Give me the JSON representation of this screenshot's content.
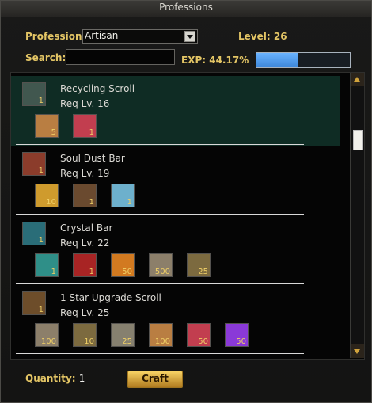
{
  "window": {
    "title": "Professions"
  },
  "header": {
    "profession_label": "Profession:",
    "profession_value": "Artisan",
    "level_label": "Level:",
    "level_value": "26",
    "search_label": "Search:",
    "search_value": "",
    "exp_label": "EXP:",
    "exp_value": "44.17%",
    "exp_fraction": 0.4417
  },
  "recipes": [
    {
      "name": "Recycling Scroll",
      "req": "Req Lv. 16",
      "output_qty": "1",
      "output_icon": "scroll-icon",
      "materials": [
        {
          "icon": "parchment-icon",
          "qty": "5"
        },
        {
          "icon": "red-book-icon",
          "qty": "1"
        }
      ]
    },
    {
      "name": "Soul Dust Bar",
      "req": "Req Lv. 19",
      "output_qty": "1",
      "output_icon": "soul-dust-bar-icon",
      "materials": [
        {
          "icon": "purple-crystal-icon",
          "qty": "10"
        },
        {
          "icon": "gold-coin-icon",
          "qty": "1"
        },
        {
          "icon": "wood-log-icon",
          "qty": "1"
        }
      ]
    },
    {
      "name": "Crystal Bar",
      "req": "Req Lv. 22",
      "output_qty": "1",
      "output_icon": "crystal-bar-icon",
      "materials": [
        {
          "icon": "blue-crystal-icon",
          "qty": "1"
        },
        {
          "icon": "teal-gem-icon",
          "qty": "1"
        },
        {
          "icon": "purple-crystal-icon",
          "qty": "50"
        },
        {
          "icon": "red-shard-icon",
          "qty": "500"
        },
        {
          "icon": "orange-orb-icon",
          "qty": "25"
        }
      ]
    },
    {
      "name": "1 Star Upgrade Scroll",
      "req": "Req Lv. 25",
      "output_qty": "1",
      "output_icon": "upgrade-scroll-icon",
      "materials": [
        {
          "icon": "parchment-icon",
          "qty": "100"
        },
        {
          "icon": "stone-ring-icon",
          "qty": "10"
        },
        {
          "icon": "red-book-icon",
          "qty": "25"
        },
        {
          "icon": "eye-orb-icon",
          "qty": "100"
        },
        {
          "icon": "bronze-compass-icon",
          "qty": "50"
        },
        {
          "icon": "bronze-wheel-icon",
          "qty": "50"
        }
      ]
    }
  ],
  "footer": {
    "quantity_label": "Quantity:",
    "quantity_value": "1",
    "craft_label": "Craft"
  }
}
